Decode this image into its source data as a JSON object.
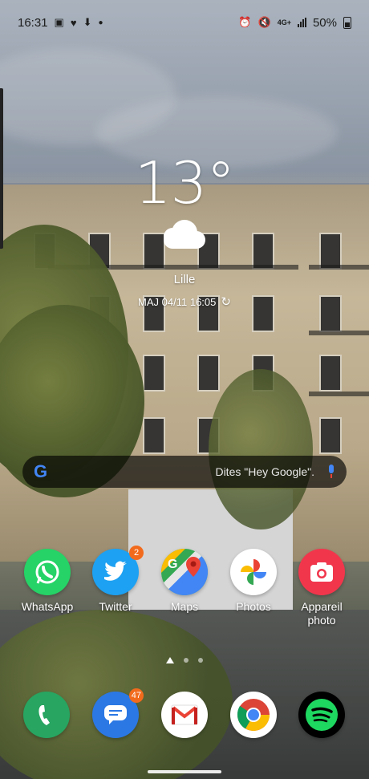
{
  "status_bar": {
    "time": "16:31",
    "left_icons": [
      "gallery-icon",
      "heart-icon",
      "download-icon",
      "notification-dot-icon"
    ],
    "network": "4G+",
    "battery": "50%"
  },
  "weather": {
    "temperature": "13°",
    "condition_icon": "cloud-icon",
    "city": "Lille",
    "updated": "MAJ 04/11 16:05"
  },
  "search": {
    "logo": "G",
    "hint": "Dites \"Hey Google\"."
  },
  "apps": [
    {
      "label": "WhatsApp",
      "icon": "whatsapp-icon",
      "color": "#25d366"
    },
    {
      "label": "Twitter",
      "icon": "twitter-icon",
      "color": "#1da1f2",
      "badge": "2"
    },
    {
      "label": "Maps",
      "icon": "maps-icon",
      "color": "#ffffff"
    },
    {
      "label": "Photos",
      "icon": "photos-icon",
      "color": "#ffffff"
    },
    {
      "label": "Appareil photo",
      "icon": "camera-icon",
      "color": "#f1364c"
    }
  ],
  "dock": [
    {
      "name": "phone",
      "icon": "phone-icon",
      "color": "#27a561"
    },
    {
      "name": "messages",
      "icon": "messages-icon",
      "color": "#2b78e4",
      "badge": "47"
    },
    {
      "name": "gmail",
      "icon": "gmail-icon",
      "color": "#ffffff"
    },
    {
      "name": "chrome",
      "icon": "chrome-icon",
      "color": "#ffffff"
    },
    {
      "name": "spotify",
      "icon": "spotify-icon",
      "color": "#000000"
    }
  ],
  "pages": {
    "count": 3,
    "current": 1
  }
}
